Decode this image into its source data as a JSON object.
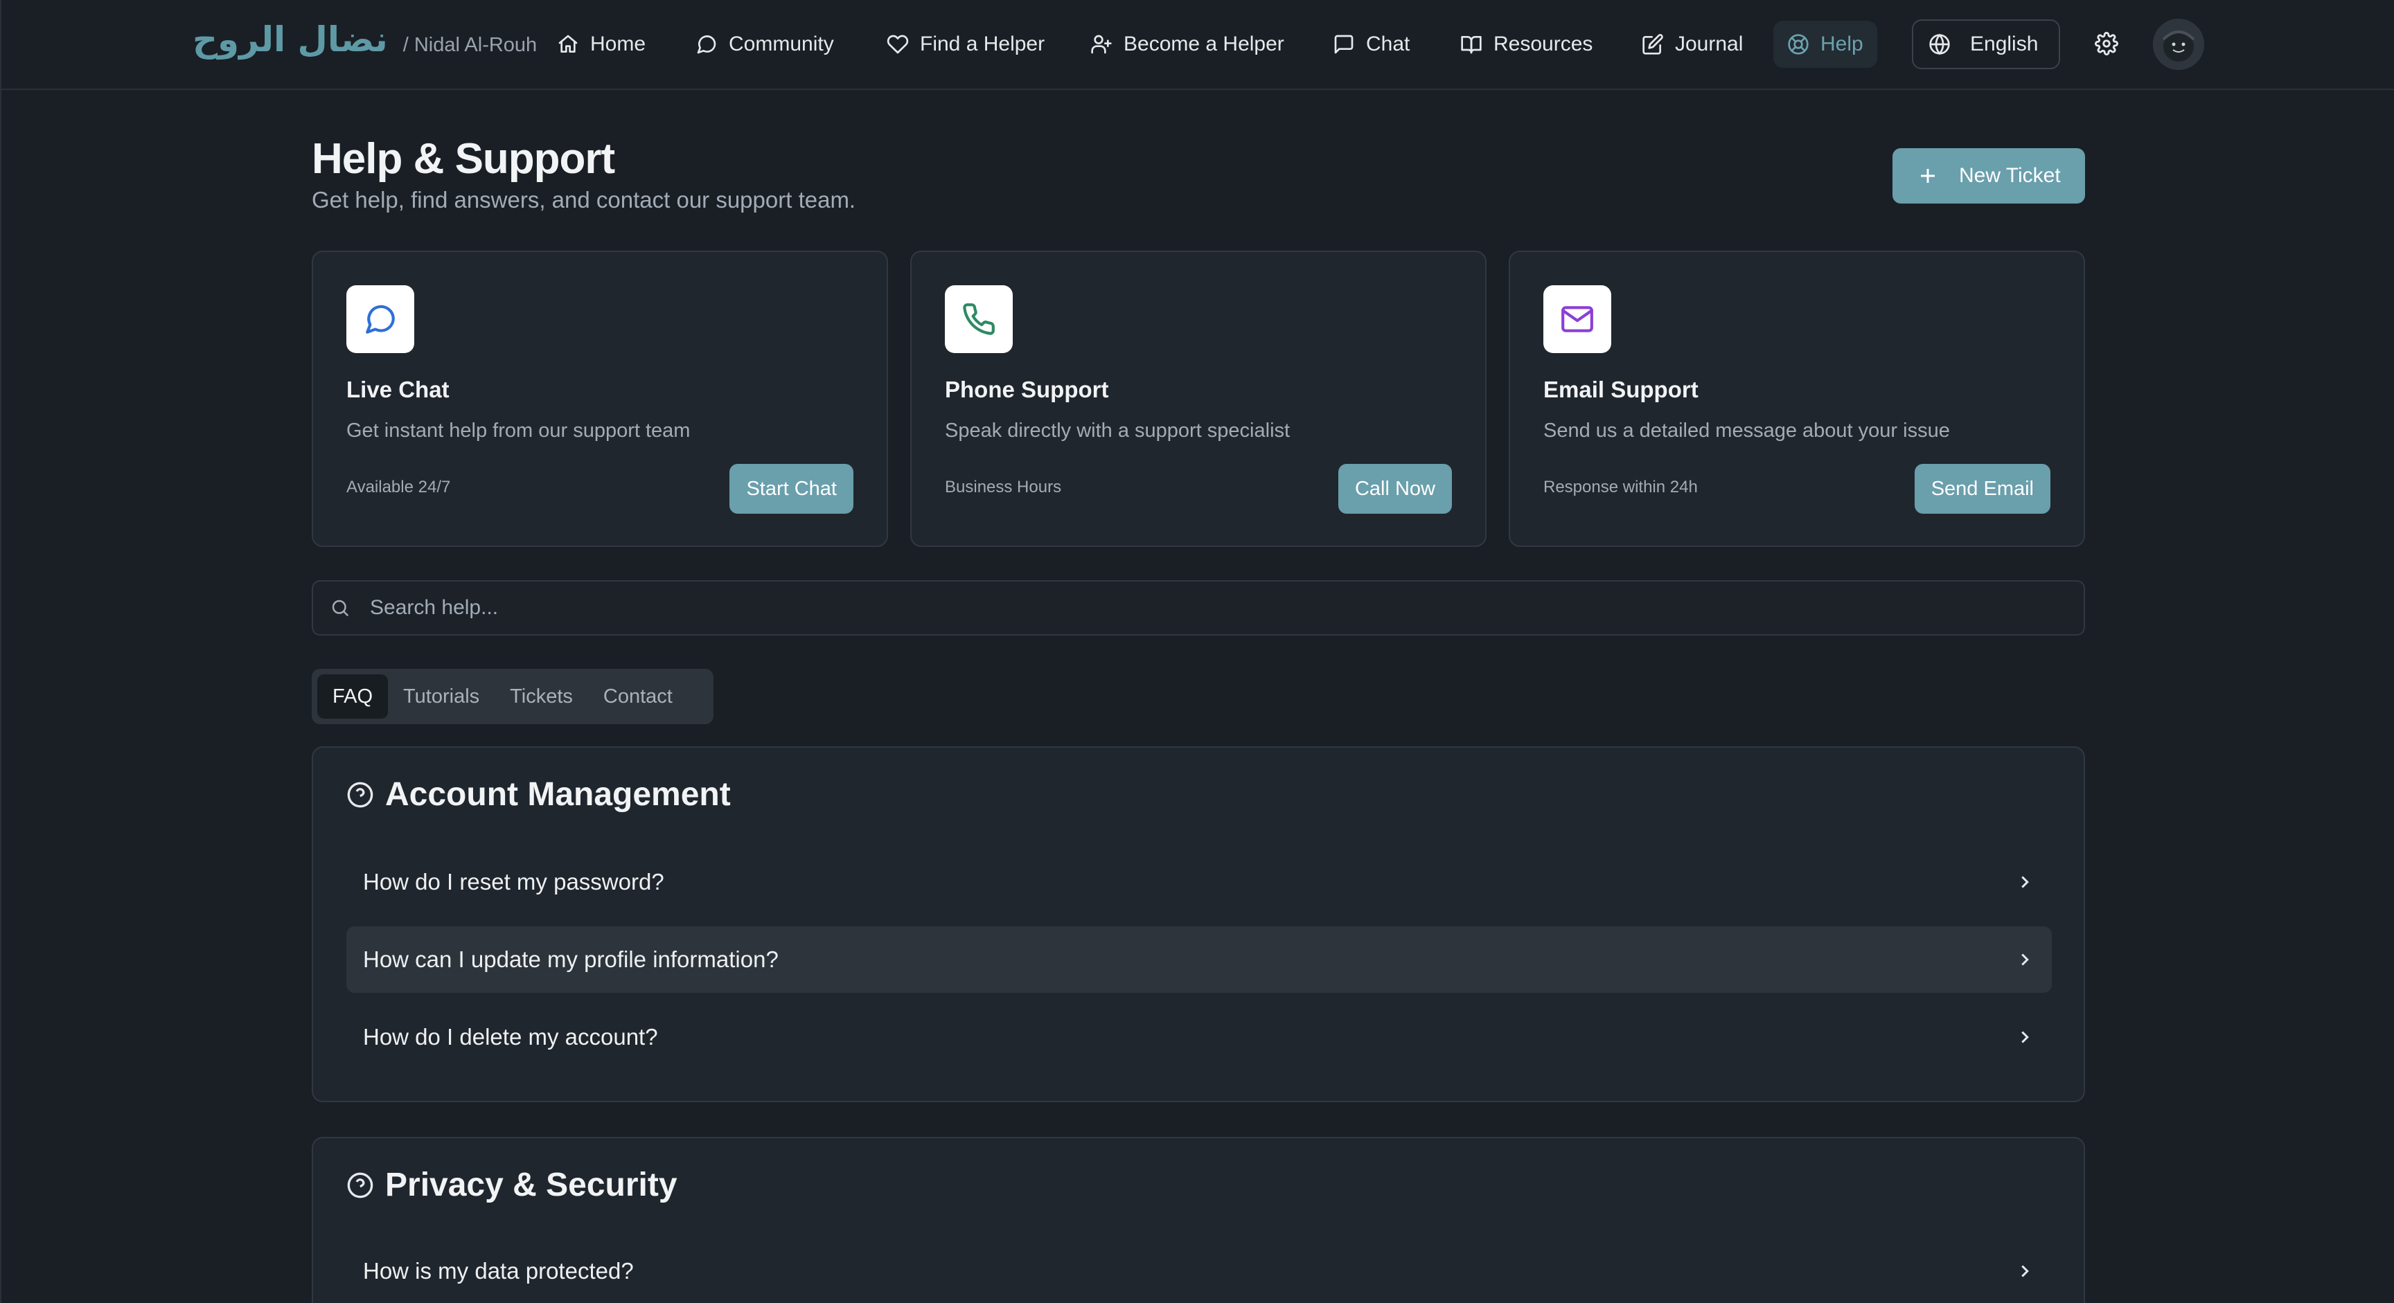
{
  "brand": {
    "arabic": "نضال الروح",
    "english": "/ Nidal Al-Rouh"
  },
  "nav": {
    "items": [
      {
        "label": "Home",
        "icon": "home-icon"
      },
      {
        "label": "Community",
        "icon": "message-circle-icon"
      },
      {
        "label": "Find a Helper",
        "icon": "heart-icon"
      },
      {
        "label": "Become a Helper",
        "icon": "user-plus-icon"
      },
      {
        "label": "Chat",
        "icon": "message-square-icon"
      },
      {
        "label": "Resources",
        "icon": "book-open-icon"
      },
      {
        "label": "Journal",
        "icon": "pen-square-icon"
      },
      {
        "label": "Help",
        "icon": "life-buoy-icon",
        "active": true
      }
    ],
    "language": "English",
    "accent_color": "#6aa3b0"
  },
  "page": {
    "title": "Help & Support",
    "subtitle": "Get help, find answers, and contact our support team.",
    "new_ticket_label": "New Ticket"
  },
  "cards": [
    {
      "title": "Live Chat",
      "description": "Get instant help from our support team",
      "note": "Available 24/7",
      "button": "Start Chat",
      "icon": "message-circle-icon",
      "icon_color": "#2f6fd6"
    },
    {
      "title": "Phone Support",
      "description": "Speak directly with a support specialist",
      "note": "Business Hours",
      "button": "Call Now",
      "icon": "phone-icon",
      "icon_color": "#2e8a63"
    },
    {
      "title": "Email Support",
      "description": "Send us a detailed message about your issue",
      "note": "Response within 24h",
      "button": "Send Email",
      "icon": "mail-icon",
      "icon_color": "#8b3fd6"
    }
  ],
  "search": {
    "placeholder": "Search help..."
  },
  "tabs": [
    {
      "label": "FAQ",
      "active": true
    },
    {
      "label": "Tutorials"
    },
    {
      "label": "Tickets"
    },
    {
      "label": "Contact"
    }
  ],
  "faq_sections": [
    {
      "title": "Account Management",
      "questions": [
        "How do I reset my password?",
        "How can I update my profile information?",
        "How do I delete my account?"
      ]
    },
    {
      "title": "Privacy & Security",
      "questions": [
        "How is my data protected?"
      ]
    }
  ],
  "colors": {
    "button": "#6a9fac",
    "background": "#1a1f25",
    "card": "#20262d"
  }
}
